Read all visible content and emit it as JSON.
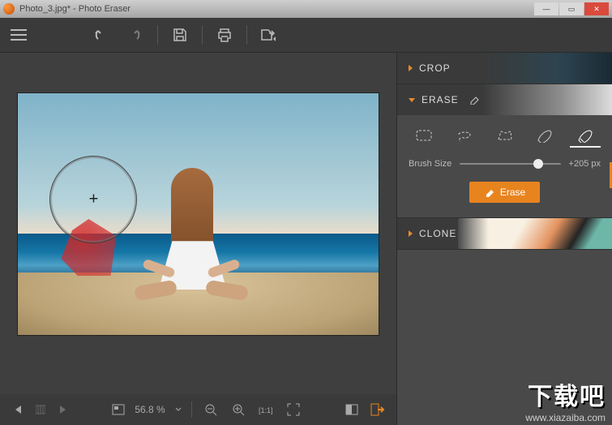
{
  "window": {
    "title": "Photo_3.jpg* - Photo Eraser"
  },
  "toolbar": {
    "menu": "menu",
    "undo": "undo",
    "redo": "redo",
    "save": "save",
    "print": "print",
    "export": "export"
  },
  "panels": {
    "crop": {
      "label": "CROP"
    },
    "erase": {
      "label": "ERASE",
      "tools": {
        "rect": "rectangle-select",
        "lasso": "lasso-select",
        "poly": "polygon-select",
        "brush": "brush-select",
        "eraser": "eraser-brush"
      },
      "brush_size_label": "Brush Size",
      "brush_size_value": "+205 px",
      "brush_size_pct": 78,
      "action_label": "Erase"
    },
    "clone": {
      "label": "CLONE"
    }
  },
  "status": {
    "zoom_value": "56.8 %",
    "prev": "prev",
    "next": "next",
    "fit": "fit",
    "zoom_out": "zoom-out",
    "zoom_in": "zoom-in",
    "one_to_one": "1:1",
    "full": "fullscreen",
    "before_after": "compare",
    "export": "export"
  },
  "watermark": {
    "big": "下载吧",
    "small": "www.xiazaiba.com"
  }
}
